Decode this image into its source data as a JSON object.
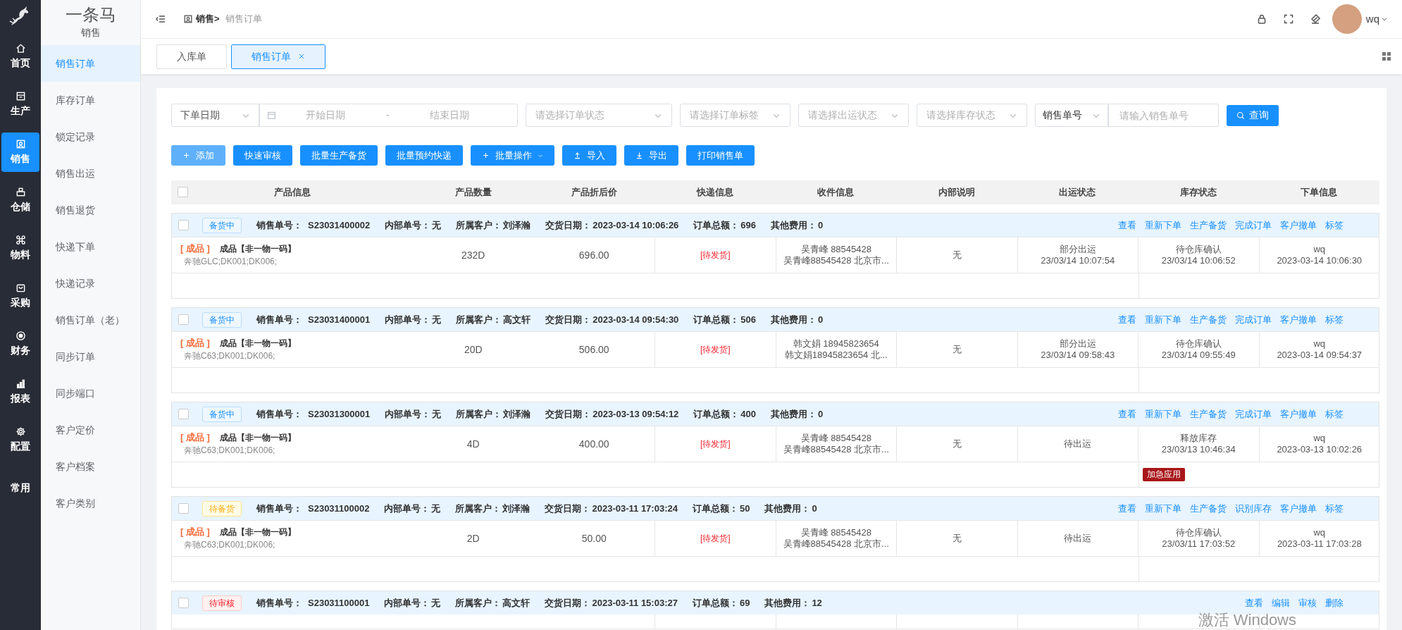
{
  "rail": {
    "items": [
      {
        "label": "首页",
        "selected": false
      },
      {
        "label": "生产",
        "selected": false
      },
      {
        "label": "销售",
        "selected": true
      },
      {
        "label": "仓储",
        "selected": false
      },
      {
        "label": "物料",
        "selected": false
      },
      {
        "label": "采购",
        "selected": false
      },
      {
        "label": "财务",
        "selected": false
      },
      {
        "label": "报表",
        "selected": false
      },
      {
        "label": "配置",
        "selected": false
      },
      {
        "label": "常用",
        "selected": false
      }
    ]
  },
  "sidebar": {
    "brand": "一条马",
    "section": "销售",
    "items": [
      {
        "label": "销售订单",
        "selected": true
      },
      {
        "label": "库存订单",
        "selected": false
      },
      {
        "label": "锁定记录",
        "selected": false
      },
      {
        "label": "销售出运",
        "selected": false
      },
      {
        "label": "销售退货",
        "selected": false
      },
      {
        "label": "快递下单",
        "selected": false
      },
      {
        "label": "快递记录",
        "selected": false
      },
      {
        "label": "销售订单（老）",
        "selected": false
      },
      {
        "label": "同步订单",
        "selected": false
      },
      {
        "label": "同步端口",
        "selected": false
      },
      {
        "label": "客户定价",
        "selected": false
      },
      {
        "label": "客户档案",
        "selected": false
      },
      {
        "label": "客户类别",
        "selected": false
      }
    ]
  },
  "breadcrumb": {
    "parent": "销售>",
    "current": "销售订单"
  },
  "user": {
    "name": "wq"
  },
  "tabs": [
    {
      "label": "入库单",
      "selected": false
    },
    {
      "label": "销售订单",
      "selected": true
    }
  ],
  "filters": {
    "date_type": "下单日期",
    "start_placeholder": "开始日期",
    "separator": "-",
    "end_placeholder": "结束日期",
    "selects": [
      "请选择订单状态",
      "请选择订单标签",
      "请选择出运状态",
      "请选择库存状态"
    ],
    "number_type": "销售单号",
    "number_placeholder": "请输入销售单号",
    "query": "查询"
  },
  "buttons": [
    {
      "label": "添加",
      "disabled": true
    },
    {
      "label": "快速审核",
      "disabled": false
    },
    {
      "label": "批量生产备货",
      "disabled": false
    },
    {
      "label": "批量预约快递",
      "disabled": false
    },
    {
      "label": "批量操作",
      "disabled": false
    },
    {
      "label": "导入",
      "disabled": false
    },
    {
      "label": "导出",
      "disabled": false
    },
    {
      "label": "打印销售单",
      "disabled": false
    }
  ],
  "table": {
    "all_checked": false,
    "columns": [
      "产品信息",
      "产品数量",
      "产品折后价",
      "快递信息",
      "收件信息",
      "内部说明",
      "出运状态",
      "库存状态",
      "下单信息"
    ],
    "orders": [
      {
        "checked": false,
        "status": {
          "text": "备货中",
          "kind": "stocking"
        },
        "fields": [
          {
            "label": "销售单号：",
            "value": "S23031400002"
          },
          {
            "label": "内部单号：",
            "value": "无"
          },
          {
            "label": "所属客户：",
            "value": "刘泽瀚"
          },
          {
            "label": "交货日期：",
            "value": "2023-03-14 10:06:26"
          },
          {
            "label": "订单总额：",
            "value": "696"
          },
          {
            "label": "其他费用：",
            "value": "0"
          }
        ],
        "actions": [
          "查看",
          "重新下单",
          "生产备货",
          "完成订单",
          "客户撤单",
          "标签"
        ],
        "item": {
          "tag": "[ 成品 ]",
          "name": "成品【非一物一码】",
          "spec": "奔驰GLC;DK001;DK006;",
          "qty": "232D",
          "price": "696.00",
          "express": "[待发货]",
          "receiver": [
            "吴青峰 88545428",
            "吴青峰88545428 北京市..."
          ],
          "internal": "无",
          "shipping": [
            "部分出运",
            "23/03/14 10:07:54"
          ],
          "stock": [
            "待仓库确认",
            "23/03/14 10:06:52"
          ],
          "info": [
            "wq",
            "2023-03-14 10:06:30"
          ]
        }
      },
      {
        "checked": false,
        "status": {
          "text": "备货中",
          "kind": "stocking"
        },
        "fields": [
          {
            "label": "销售单号：",
            "value": "S23031400001"
          },
          {
            "label": "内部单号：",
            "value": "无"
          },
          {
            "label": "所属客户：",
            "value": "高文轩"
          },
          {
            "label": "交货日期：",
            "value": "2023-03-14 09:54:30"
          },
          {
            "label": "订单总额：",
            "value": "506"
          },
          {
            "label": "其他费用：",
            "value": "0"
          }
        ],
        "actions": [
          "查看",
          "重新下单",
          "生产备货",
          "完成订单",
          "客户撤单",
          "标签"
        ],
        "item": {
          "tag": "[ 成品 ]",
          "name": "成品【非一物一码】",
          "spec": "奔驰C63;DK001;DK006;",
          "qty": "20D",
          "price": "506.00",
          "express": "[待发货]",
          "receiver": [
            "韩文娟 18945823654",
            "韩文娟18945823654 北..."
          ],
          "internal": "无",
          "shipping": [
            "部分出运",
            "23/03/14 09:58:43"
          ],
          "stock": [
            "待仓库确认",
            "23/03/14 09:55:49"
          ],
          "info": [
            "wq",
            "2023-03-14 09:54:37"
          ]
        }
      },
      {
        "checked": false,
        "status": {
          "text": "备货中",
          "kind": "stocking"
        },
        "fields": [
          {
            "label": "销售单号：",
            "value": "S23031300001"
          },
          {
            "label": "内部单号：",
            "value": "无"
          },
          {
            "label": "所属客户：",
            "value": "刘泽瀚"
          },
          {
            "label": "交货日期：",
            "value": "2023-03-13 09:54:12"
          },
          {
            "label": "订单总额：",
            "value": "400"
          },
          {
            "label": "其他费用：",
            "value": "0"
          }
        ],
        "actions": [
          "查看",
          "重新下单",
          "生产备货",
          "完成订单",
          "客户撤单",
          "标签"
        ],
        "item": {
          "tag": "[ 成品 ]",
          "name": "成品【非一物一码】",
          "spec": "奔驰C63;DK001;DK006;",
          "qty": "4D",
          "price": "400.00",
          "express": "[待发货]",
          "receiver": [
            "吴青峰 88545428",
            "吴青峰88545428 北京市..."
          ],
          "internal": "无",
          "shipping": [
            "待出运"
          ],
          "stock": [
            "释放库存",
            "23/03/13 10:46:34"
          ],
          "info": [
            "wq",
            "2023-03-13 10:02:26"
          ]
        },
        "badge": "加急应用"
      },
      {
        "checked": false,
        "status": {
          "text": "待备货",
          "kind": "waiting"
        },
        "fields": [
          {
            "label": "销售单号：",
            "value": "S23031100002"
          },
          {
            "label": "内部单号：",
            "value": "无"
          },
          {
            "label": "所属客户：",
            "value": "刘泽瀚"
          },
          {
            "label": "交货日期：",
            "value": "2023-03-11 17:03:24"
          },
          {
            "label": "订单总额：",
            "value": "50"
          },
          {
            "label": "其他费用：",
            "value": "0"
          }
        ],
        "actions": [
          "查看",
          "重新下单",
          "生产备货",
          "识别库存",
          "客户撤单",
          "标签"
        ],
        "item": {
          "tag": "[ 成品 ]",
          "name": "成品【非一物一码】",
          "spec": "奔驰C63;DK001;DK006;",
          "qty": "2D",
          "price": "50.00",
          "express": "[待发货]",
          "receiver": [
            "吴青峰 88545428",
            "吴青峰88545428 北京市..."
          ],
          "internal": "无",
          "shipping": [
            "待出运"
          ],
          "stock": [
            "待仓库确认",
            "23/03/11 17:03:52"
          ],
          "info": [
            "wq",
            "2023-03-11 17:03:28"
          ]
        }
      },
      {
        "checked": false,
        "status": {
          "text": "待审核",
          "kind": "review"
        },
        "fields": [
          {
            "label": "销售单号：",
            "value": "S23031100001"
          },
          {
            "label": "内部单号：",
            "value": "无"
          },
          {
            "label": "所属客户：",
            "value": "高文轩"
          },
          {
            "label": "交货日期：",
            "value": "2023-03-11 15:03:27"
          },
          {
            "label": "订单总额：",
            "value": "69"
          },
          {
            "label": "其他费用：",
            "value": "12"
          }
        ],
        "actions": [
          "查看",
          "编辑",
          "审核",
          "删除"
        ]
      }
    ]
  },
  "os_notice": "激活 Windows"
}
